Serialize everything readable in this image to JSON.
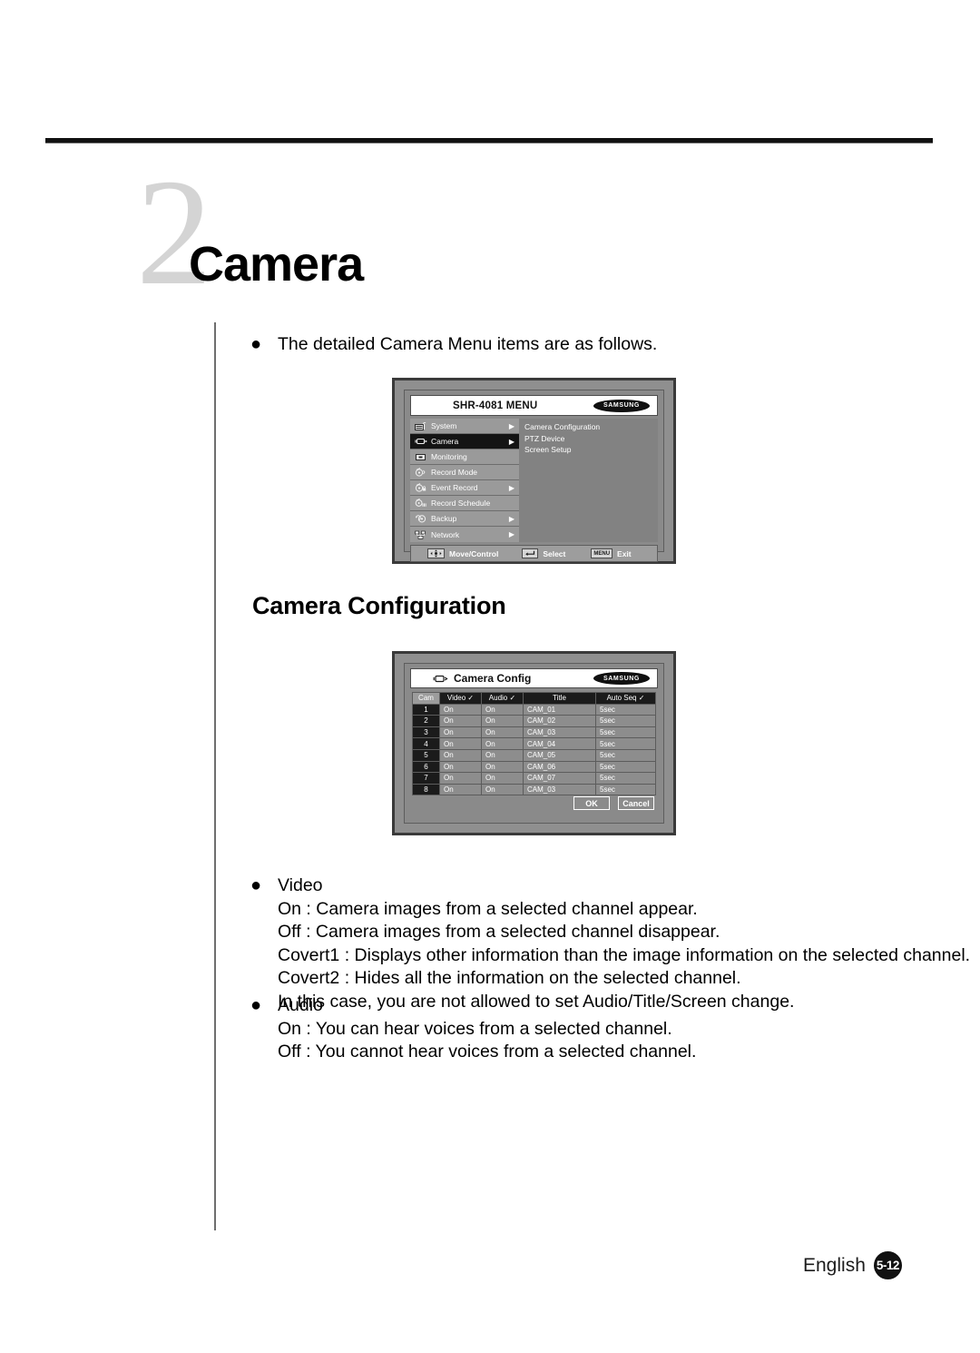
{
  "page": {
    "chapter_number": "2",
    "chapter_title": "Camera",
    "intro_bullet": "The detailed Camera Menu items are as follows.",
    "section_heading": "Camera Configuration",
    "footer_language": "English",
    "footer_page": "5-12"
  },
  "menu_osd": {
    "title": "SHR-4081 MENU",
    "brand": "SAMSUNG",
    "items": [
      {
        "label": "System",
        "icon": "system-icon",
        "arrow": "▶",
        "selected": false
      },
      {
        "label": "Camera",
        "icon": "camera-icon",
        "arrow": "▶",
        "selected": true
      },
      {
        "label": "Monitoring",
        "icon": "monitor-icon",
        "arrow": "",
        "selected": false
      },
      {
        "label": "Record Mode",
        "icon": "record-mode-icon",
        "arrow": "",
        "selected": false
      },
      {
        "label": "Event Record",
        "icon": "event-record-icon",
        "arrow": "▶",
        "selected": false
      },
      {
        "label": "Record Schedule",
        "icon": "record-schedule-icon",
        "arrow": "",
        "selected": false
      },
      {
        "label": "Backup",
        "icon": "backup-icon",
        "arrow": "▶",
        "selected": false
      },
      {
        "label": "Network",
        "icon": "network-icon",
        "arrow": "▶",
        "selected": false
      }
    ],
    "submenu": [
      "Camera Configuration",
      "PTZ Device",
      "Screen Setup"
    ],
    "footer": [
      {
        "key": "✥",
        "label": "Move/Control",
        "icon": "dpad-icon"
      },
      {
        "key": "↵",
        "label": "Select",
        "icon": "enter-icon"
      },
      {
        "key": "MENU",
        "label": "Exit",
        "icon": "menu-icon"
      }
    ]
  },
  "config_osd": {
    "title": "Camera Config",
    "brand": "SAMSUNG",
    "title_icon": "camera-icon",
    "columns": [
      "Cam",
      "Video ✓",
      "Audio ✓",
      "Title",
      "Auto Seq ✓"
    ],
    "rows": [
      {
        "cam": "1",
        "video": "On",
        "audio": "On",
        "title": "CAM_01",
        "seq": "5sec"
      },
      {
        "cam": "2",
        "video": "On",
        "audio": "On",
        "title": "CAM_02",
        "seq": "5sec"
      },
      {
        "cam": "3",
        "video": "On",
        "audio": "On",
        "title": "CAM_03",
        "seq": "5sec"
      },
      {
        "cam": "4",
        "video": "On",
        "audio": "On",
        "title": "CAM_04",
        "seq": "5sec"
      },
      {
        "cam": "5",
        "video": "On",
        "audio": "On",
        "title": "CAM_05",
        "seq": "5sec"
      },
      {
        "cam": "6",
        "video": "On",
        "audio": "On",
        "title": "CAM_06",
        "seq": "5sec"
      },
      {
        "cam": "7",
        "video": "On",
        "audio": "On",
        "title": "CAM_07",
        "seq": "5sec"
      },
      {
        "cam": "8",
        "video": "On",
        "audio": "On",
        "title": "CAM_03",
        "seq": "5sec"
      }
    ],
    "ok_label": "OK",
    "cancel_label": "Cancel"
  },
  "video_section": {
    "heading": "Video",
    "lines": [
      "On : Camera images from a selected channel appear.",
      "Off : Camera images from a selected channel disappear.",
      "Covert1 : Displays other information than the image information on the selected channel.",
      "Covert2 : Hides all the information on the selected channel.",
      "In this case, you are not allowed to set Audio/Title/Screen change."
    ]
  },
  "audio_section": {
    "heading": "Audio",
    "lines": [
      "On : You can hear voices from a selected channel.",
      "Off : You cannot hear voices from a selected channel."
    ]
  }
}
